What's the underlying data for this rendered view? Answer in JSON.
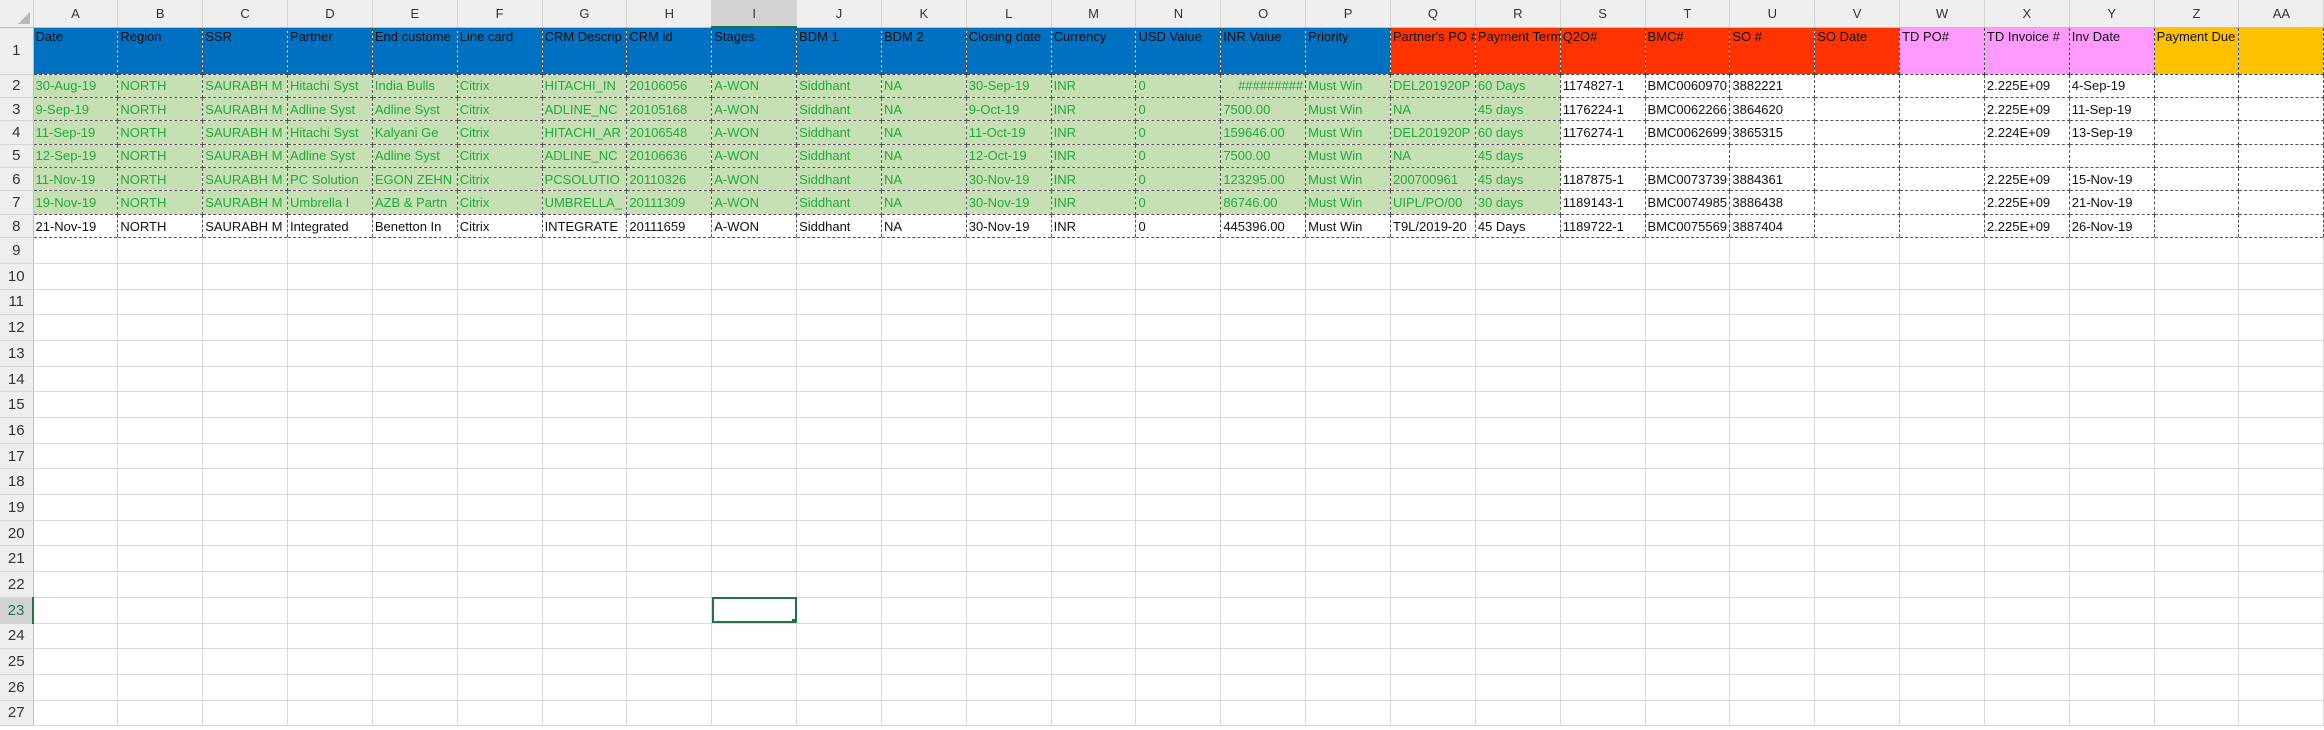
{
  "columns": [
    "A",
    "B",
    "C",
    "D",
    "E",
    "F",
    "G",
    "H",
    "I",
    "J",
    "K",
    "L",
    "M",
    "N",
    "O",
    "P",
    "Q",
    "R",
    "S",
    "T",
    "U",
    "V",
    "W",
    "X",
    "Y",
    "Z",
    "AA"
  ],
  "selected_cell": {
    "column": "I",
    "row": 23
  },
  "colors": {
    "blue": "#0070c0",
    "red": "#ff3300",
    "pink": "#ff99ff",
    "orange": "#ffc000",
    "green_fill": "#c6e0b4",
    "green_text": "#1faa3c",
    "selection": "#217346"
  },
  "header_row": {
    "cells": [
      "Date",
      "Region",
      "SSR",
      "Partner",
      "End custome",
      "Line card",
      "CRM Descrip",
      "CRM id",
      "Stages",
      "BDM 1",
      "BDM 2",
      "Closing date",
      "Currency",
      "USD Value",
      "INR Value",
      "Priority",
      "Partner's PO #",
      "Payment Term",
      "Q2O#",
      "BMC#",
      "SO #",
      "SO Date",
      "TD PO#",
      "TD Invoice #",
      "Inv Date",
      "Payment Due date",
      ""
    ],
    "fills": [
      "blue",
      "blue",
      "blue",
      "blue",
      "blue",
      "blue",
      "blue",
      "blue",
      "blue",
      "blue",
      "blue",
      "blue",
      "blue",
      "blue",
      "blue",
      "blue",
      "red",
      "red",
      "red",
      "red",
      "red",
      "red",
      "pink",
      "pink",
      "pink",
      "orange",
      "orange"
    ]
  },
  "data_rows": [
    {
      "green_cols": 18,
      "cells": [
        "30-Aug-19",
        "NORTH",
        "SAURABH M",
        "Hitachi Syst",
        "India Bulls",
        "Citrix",
        "HITACHI_IN",
        "20106056",
        "A-WON",
        "Siddhant",
        "NA",
        "30-Sep-19",
        "INR",
        "0",
        "#########",
        "Must Win",
        "DEL201920P",
        "60 Days",
        "1174827-1",
        "BMC0060970",
        "3882221",
        "",
        "",
        "2.225E+09",
        "4-Sep-19",
        "",
        ""
      ]
    },
    {
      "green_cols": 18,
      "cells": [
        "9-Sep-19",
        "NORTH",
        "SAURABH M",
        "Adline Syst",
        "Adline Syst",
        "Citrix",
        "ADLINE_NC",
        "20105168",
        "A-WON",
        "Siddhant",
        "NA",
        "9-Oct-19",
        "INR",
        "0",
        "7500.00",
        "Must Win",
        "NA",
        "45 days",
        "1176224-1",
        "BMC0062266",
        "3864620",
        "",
        "",
        "2.225E+09",
        "11-Sep-19",
        "",
        ""
      ]
    },
    {
      "green_cols": 18,
      "cells": [
        "11-Sep-19",
        "NORTH",
        "SAURABH M",
        "Hitachi Syst",
        "Kalyani Ge",
        "Citrix",
        "HITACHI_AR",
        "20106548",
        "A-WON",
        "Siddhant",
        "NA",
        "11-Oct-19",
        "INR",
        "0",
        "159646.00",
        "Must Win",
        "DEL201920P",
        "60 days",
        "1176274-1",
        "BMC0062699",
        "3865315",
        "",
        "",
        "2.224E+09",
        "13-Sep-19",
        "",
        ""
      ]
    },
    {
      "green_cols": 18,
      "cells": [
        "12-Sep-19",
        "NORTH",
        "SAURABH M",
        "Adline Syst",
        "Adline Syst",
        "Citrix",
        "ADLINE_NC",
        "20106636",
        "A-WON",
        "Siddhant",
        "NA",
        "12-Oct-19",
        "INR",
        "0",
        "7500.00",
        "Must Win",
        "NA",
        "45 days",
        "",
        "",
        "",
        "",
        "",
        "",
        "",
        "",
        ""
      ]
    },
    {
      "green_cols": 18,
      "cells": [
        "11-Nov-19",
        "NORTH",
        "SAURABH M",
        "PC Solution",
        "EGON ZEHN",
        "Citrix",
        "PCSOLUTIO",
        "20110326",
        "A-WON",
        "Siddhant",
        "NA",
        "30-Nov-19",
        "INR",
        "0",
        "123295.00",
        "Must Win",
        "200700961",
        "45 days",
        "1187875-1",
        "BMC0073739",
        "3884361",
        "",
        "",
        "2.225E+09",
        "15-Nov-19",
        "",
        ""
      ]
    },
    {
      "green_cols": 18,
      "cells": [
        "19-Nov-19",
        "NORTH",
        "SAURABH M",
        "Umbrella I",
        "AZB & Partn",
        "Citrix",
        "UMBRELLA_",
        "20111309",
        "A-WON",
        "Siddhant",
        "NA",
        "30-Nov-19",
        "INR",
        "0",
        "86746.00",
        "Must Win",
        "UIPL/PO/00",
        "30 days",
        "1189143-1",
        "BMC0074985",
        "3886438",
        "",
        "",
        "2.225E+09",
        "21-Nov-19",
        "",
        ""
      ]
    },
    {
      "green_cols": 0,
      "cells": [
        "21-Nov-19",
        "NORTH",
        "SAURABH M",
        "Integrated",
        "Benetton In",
        "Citrix",
        "INTEGRATE",
        "20111659",
        "A-WON",
        "Siddhant",
        "NA",
        "30-Nov-19",
        "INR",
        "0",
        "445396.00",
        "Must Win",
        "T9L/2019-20",
        "45 Days",
        "1189722-1",
        "BMC0075569",
        "3887404",
        "",
        "",
        "2.225E+09",
        "26-Nov-19",
        "",
        ""
      ]
    }
  ],
  "row_numbers": [
    "1",
    "2",
    "3",
    "4",
    "5",
    "6",
    "7",
    "8",
    "9",
    "10",
    "11",
    "12",
    "13",
    "14",
    "15",
    "16",
    "17",
    "18",
    "19",
    "20",
    "21",
    "22",
    "23",
    "24",
    "25",
    "26",
    "27"
  ]
}
